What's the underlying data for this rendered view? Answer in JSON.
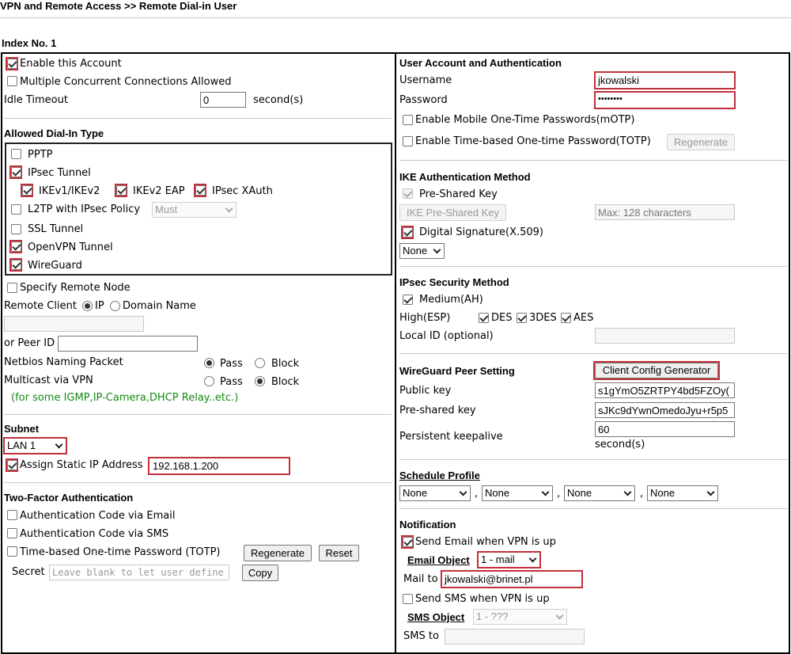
{
  "breadcrumb": "VPN and Remote Access >> Remote Dial-in User",
  "index_label": "Index No. 1",
  "left": {
    "enable_account": "Enable this Account",
    "multiple_connections": "Multiple Concurrent Connections Allowed",
    "idle_timeout_label": "Idle Timeout",
    "idle_timeout_value": "0",
    "idle_timeout_unit": "second(s)",
    "dialin_title": "Allowed Dial-In Type",
    "pptp": "PPTP",
    "ipsec_tunnel": "IPsec Tunnel",
    "ikev1v2": "IKEv1/IKEv2",
    "ikev2_eap": "IKEv2 EAP",
    "ipsec_xauth": "IPsec XAuth",
    "l2tp": "L2TP with IPsec Policy",
    "l2tp_policy": "Must",
    "ssl_tunnel": "SSL Tunnel",
    "openvpn": "OpenVPN Tunnel",
    "wireguard": "WireGuard",
    "specify_remote": "Specify Remote Node",
    "remote_client": "Remote Client",
    "ip": "IP",
    "domain_name": "Domain Name",
    "peer_id": "or Peer ID",
    "netbios": "Netbios Naming Packet",
    "multicast": "Multicast via VPN",
    "pass": "Pass",
    "block": "Block",
    "multicast_note": "(for some IGMP,IP-Camera,DHCP Relay..etc.)",
    "subnet_title": "Subnet",
    "subnet_value": "LAN 1",
    "assign_static": "Assign Static IP Address",
    "static_ip": "192.168.1.200",
    "tfa_title": "Two-Factor Authentication",
    "auth_email": "Authentication Code via Email",
    "auth_sms": "Authentication Code via SMS",
    "totp": "Time-based One-time Password (TOTP)",
    "regenerate": "Regenerate",
    "reset": "Reset",
    "secret_label": "Secret",
    "secret_placeholder": "Leave blank to let user define",
    "copy": "Copy"
  },
  "right": {
    "account_title": "User Account and Authentication",
    "username_label": "Username",
    "username_value": "jkowalski",
    "password_label": "Password",
    "password_value": "••••••••",
    "motp": "Enable Mobile One-Time Passwords(mOTP)",
    "totp": "Enable Time-based One-time Password(TOTP)",
    "regenerate": "Regenerate",
    "ike_title": "IKE Authentication Method",
    "psk": "Pre-Shared Key",
    "ike_psk_button": "IKE Pre-Shared Key",
    "psk_placeholder": "Max: 128 characters",
    "digital_sig": "Digital Signature(X.509)",
    "cert_value": "None",
    "ipsec_title": "IPsec Security Method",
    "medium": "Medium(AH)",
    "high": "High(ESP)",
    "des": "DES",
    "des3": "3DES",
    "aes": "AES",
    "local_id": "Local ID (optional)",
    "wg_title": "WireGuard Peer Setting",
    "client_config": "Client Config Generator",
    "public_key_label": "Public key",
    "public_key_value": "s1gYmO5ZRTPY4bd5FZOy(",
    "preshared_label": "Pre-shared key",
    "preshared_value": "sJKc9dYwnOmedoJyu+r5p5",
    "keepalive_label": "Persistent keepalive",
    "keepalive_value": "60",
    "keepalive_unit": "second(s)",
    "schedule_title": "Schedule Profile",
    "schedule_values": [
      "None",
      "None",
      "None",
      "None"
    ],
    "comma": ",",
    "notification_title": "Notification",
    "send_email": "Send Email when VPN is up",
    "email_object_label": "Email Object",
    "email_object_value": "1 - mail",
    "mail_to_label": "Mail to",
    "mail_to_value": "jkowalski@brinet.pl",
    "send_sms": "Send SMS when VPN is up",
    "sms_object_label": "SMS Object",
    "sms_object_value": "1 - ???",
    "sms_to_label": "SMS to"
  },
  "colors": {
    "highlight": "#c0303a",
    "note_green": "#148a14",
    "border": "#000000"
  }
}
